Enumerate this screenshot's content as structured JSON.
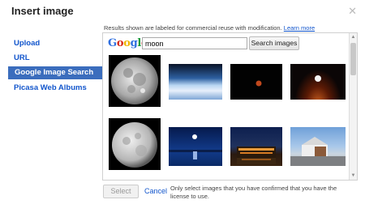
{
  "dialog": {
    "title": "Insert image",
    "close_icon": "close-icon"
  },
  "notice": {
    "text": "Results shown are labeled for commercial reuse with modification.",
    "learn_more": "Learn more"
  },
  "sidebar": {
    "items": [
      {
        "label": "Upload",
        "selected": false
      },
      {
        "label": "URL",
        "selected": false
      },
      {
        "label": "Google Image Search",
        "selected": true
      },
      {
        "label": "Picasa Web Albums",
        "selected": false
      }
    ]
  },
  "search": {
    "logo": "Google",
    "query": "moon",
    "button_label": "Search images"
  },
  "results": {
    "thumbnails": [
      {
        "icon": "full-moon-image"
      },
      {
        "icon": "earth-horizon-image"
      },
      {
        "icon": "small-red-moon-image"
      },
      {
        "icon": "moon-over-horizon-image"
      },
      {
        "icon": "moon-closeup-image"
      },
      {
        "icon": "moon-over-water-image"
      },
      {
        "icon": "lit-building-night-image"
      },
      {
        "icon": "house-under-sky-image"
      }
    ]
  },
  "footer": {
    "select_label": "Select",
    "cancel_label": "Cancel",
    "note": "Only select images that you have confirmed that you have the license to use."
  },
  "colors": {
    "selected_nav": "#3b6dbd",
    "link": "#1155cc",
    "google_blue": "#2f6fe0",
    "google_red": "#d62b1b",
    "google_yellow": "#f0b400",
    "google_green": "#1a9b3b"
  }
}
